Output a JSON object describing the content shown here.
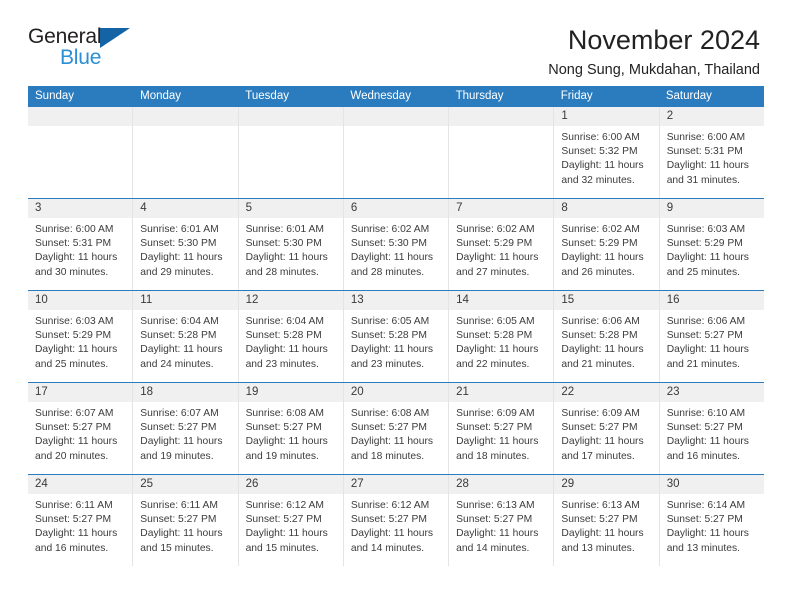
{
  "brand": {
    "name_part1": "General",
    "name_part2": "Blue",
    "accent_color": "#1464a5",
    "accent_color_light": "#2a8fd4"
  },
  "header": {
    "title": "November 2024",
    "subtitle": "Nong Sung, Mukdahan, Thailand"
  },
  "calendar": {
    "header_color": "#2b7cbf",
    "weekdays": [
      "Sunday",
      "Monday",
      "Tuesday",
      "Wednesday",
      "Thursday",
      "Friday",
      "Saturday"
    ],
    "weeks": [
      [
        {
          "day": "",
          "empty": true
        },
        {
          "day": "",
          "empty": true
        },
        {
          "day": "",
          "empty": true
        },
        {
          "day": "",
          "empty": true
        },
        {
          "day": "",
          "empty": true
        },
        {
          "day": "1",
          "sunrise": "Sunrise: 6:00 AM",
          "sunset": "Sunset: 5:32 PM",
          "daylight": "Daylight: 11 hours and 32 minutes."
        },
        {
          "day": "2",
          "sunrise": "Sunrise: 6:00 AM",
          "sunset": "Sunset: 5:31 PM",
          "daylight": "Daylight: 11 hours and 31 minutes."
        }
      ],
      [
        {
          "day": "3",
          "sunrise": "Sunrise: 6:00 AM",
          "sunset": "Sunset: 5:31 PM",
          "daylight": "Daylight: 11 hours and 30 minutes."
        },
        {
          "day": "4",
          "sunrise": "Sunrise: 6:01 AM",
          "sunset": "Sunset: 5:30 PM",
          "daylight": "Daylight: 11 hours and 29 minutes."
        },
        {
          "day": "5",
          "sunrise": "Sunrise: 6:01 AM",
          "sunset": "Sunset: 5:30 PM",
          "daylight": "Daylight: 11 hours and 28 minutes."
        },
        {
          "day": "6",
          "sunrise": "Sunrise: 6:02 AM",
          "sunset": "Sunset: 5:30 PM",
          "daylight": "Daylight: 11 hours and 28 minutes."
        },
        {
          "day": "7",
          "sunrise": "Sunrise: 6:02 AM",
          "sunset": "Sunset: 5:29 PM",
          "daylight": "Daylight: 11 hours and 27 minutes."
        },
        {
          "day": "8",
          "sunrise": "Sunrise: 6:02 AM",
          "sunset": "Sunset: 5:29 PM",
          "daylight": "Daylight: 11 hours and 26 minutes."
        },
        {
          "day": "9",
          "sunrise": "Sunrise: 6:03 AM",
          "sunset": "Sunset: 5:29 PM",
          "daylight": "Daylight: 11 hours and 25 minutes."
        }
      ],
      [
        {
          "day": "10",
          "sunrise": "Sunrise: 6:03 AM",
          "sunset": "Sunset: 5:29 PM",
          "daylight": "Daylight: 11 hours and 25 minutes."
        },
        {
          "day": "11",
          "sunrise": "Sunrise: 6:04 AM",
          "sunset": "Sunset: 5:28 PM",
          "daylight": "Daylight: 11 hours and 24 minutes."
        },
        {
          "day": "12",
          "sunrise": "Sunrise: 6:04 AM",
          "sunset": "Sunset: 5:28 PM",
          "daylight": "Daylight: 11 hours and 23 minutes."
        },
        {
          "day": "13",
          "sunrise": "Sunrise: 6:05 AM",
          "sunset": "Sunset: 5:28 PM",
          "daylight": "Daylight: 11 hours and 23 minutes."
        },
        {
          "day": "14",
          "sunrise": "Sunrise: 6:05 AM",
          "sunset": "Sunset: 5:28 PM",
          "daylight": "Daylight: 11 hours and 22 minutes."
        },
        {
          "day": "15",
          "sunrise": "Sunrise: 6:06 AM",
          "sunset": "Sunset: 5:28 PM",
          "daylight": "Daylight: 11 hours and 21 minutes."
        },
        {
          "day": "16",
          "sunrise": "Sunrise: 6:06 AM",
          "sunset": "Sunset: 5:27 PM",
          "daylight": "Daylight: 11 hours and 21 minutes."
        }
      ],
      [
        {
          "day": "17",
          "sunrise": "Sunrise: 6:07 AM",
          "sunset": "Sunset: 5:27 PM",
          "daylight": "Daylight: 11 hours and 20 minutes."
        },
        {
          "day": "18",
          "sunrise": "Sunrise: 6:07 AM",
          "sunset": "Sunset: 5:27 PM",
          "daylight": "Daylight: 11 hours and 19 minutes."
        },
        {
          "day": "19",
          "sunrise": "Sunrise: 6:08 AM",
          "sunset": "Sunset: 5:27 PM",
          "daylight": "Daylight: 11 hours and 19 minutes."
        },
        {
          "day": "20",
          "sunrise": "Sunrise: 6:08 AM",
          "sunset": "Sunset: 5:27 PM",
          "daylight": "Daylight: 11 hours and 18 minutes."
        },
        {
          "day": "21",
          "sunrise": "Sunrise: 6:09 AM",
          "sunset": "Sunset: 5:27 PM",
          "daylight": "Daylight: 11 hours and 18 minutes."
        },
        {
          "day": "22",
          "sunrise": "Sunrise: 6:09 AM",
          "sunset": "Sunset: 5:27 PM",
          "daylight": "Daylight: 11 hours and 17 minutes."
        },
        {
          "day": "23",
          "sunrise": "Sunrise: 6:10 AM",
          "sunset": "Sunset: 5:27 PM",
          "daylight": "Daylight: 11 hours and 16 minutes."
        }
      ],
      [
        {
          "day": "24",
          "sunrise": "Sunrise: 6:11 AM",
          "sunset": "Sunset: 5:27 PM",
          "daylight": "Daylight: 11 hours and 16 minutes."
        },
        {
          "day": "25",
          "sunrise": "Sunrise: 6:11 AM",
          "sunset": "Sunset: 5:27 PM",
          "daylight": "Daylight: 11 hours and 15 minutes."
        },
        {
          "day": "26",
          "sunrise": "Sunrise: 6:12 AM",
          "sunset": "Sunset: 5:27 PM",
          "daylight": "Daylight: 11 hours and 15 minutes."
        },
        {
          "day": "27",
          "sunrise": "Sunrise: 6:12 AM",
          "sunset": "Sunset: 5:27 PM",
          "daylight": "Daylight: 11 hours and 14 minutes."
        },
        {
          "day": "28",
          "sunrise": "Sunrise: 6:13 AM",
          "sunset": "Sunset: 5:27 PM",
          "daylight": "Daylight: 11 hours and 14 minutes."
        },
        {
          "day": "29",
          "sunrise": "Sunrise: 6:13 AM",
          "sunset": "Sunset: 5:27 PM",
          "daylight": "Daylight: 11 hours and 13 minutes."
        },
        {
          "day": "30",
          "sunrise": "Sunrise: 6:14 AM",
          "sunset": "Sunset: 5:27 PM",
          "daylight": "Daylight: 11 hours and 13 minutes."
        }
      ]
    ]
  }
}
